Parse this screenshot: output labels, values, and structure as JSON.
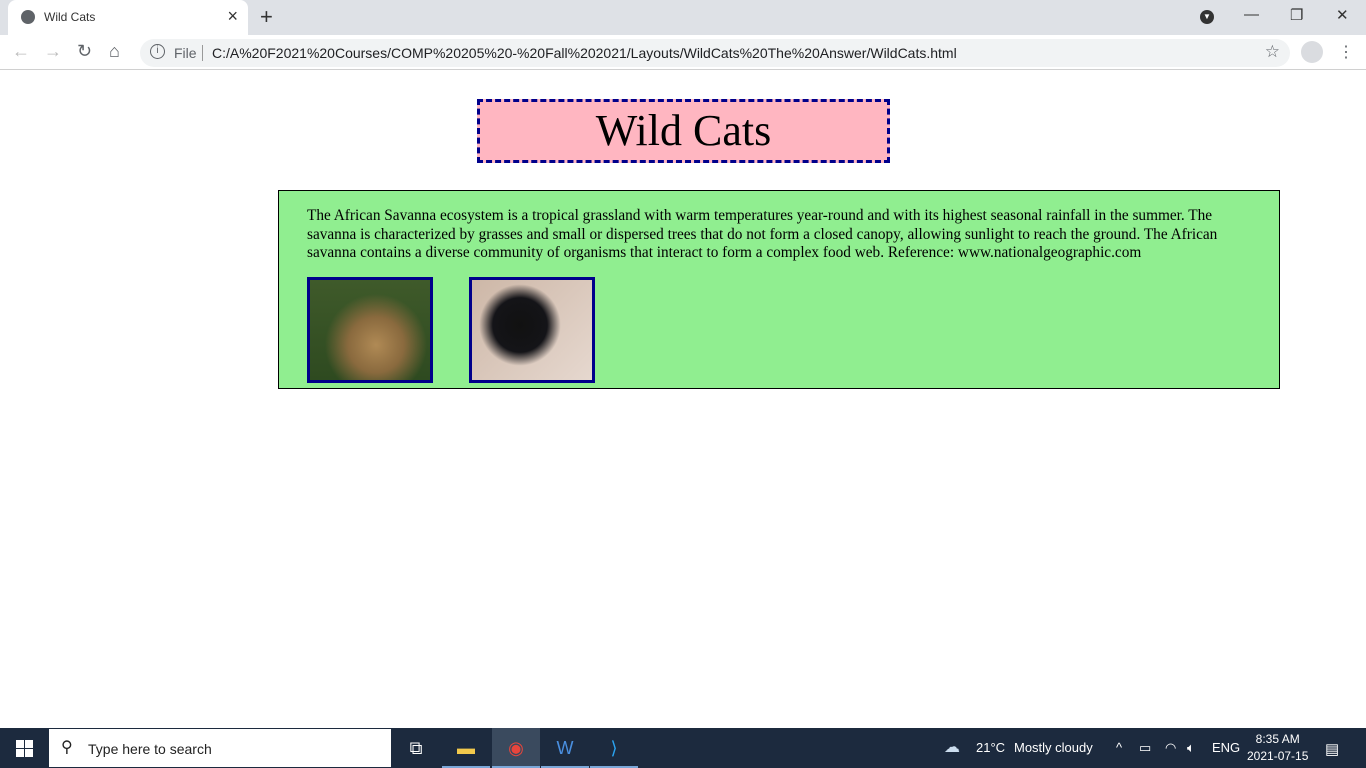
{
  "browser": {
    "tab_title": "Wild Cats",
    "file_label": "File",
    "url": "C:/A%20F2021%20Courses/COMP%20205%20-%20Fall%202021/Layouts/WildCats%20The%20Answer/WildCats.html"
  },
  "page": {
    "heading": "Wild Cats",
    "paragraph": "The African Savanna ecosystem is a tropical grassland with warm temperatures year-round and with its highest seasonal rainfall in the summer. The savanna is characterized by grasses and small or dispersed trees that do not form a closed canopy, allowing sunlight to reach the ground. The African savanna contains a diverse community of organisms that interact to form a complex food web. Reference: www.nationalgeographic.com",
    "images": [
      "leopard",
      "black panther"
    ]
  },
  "taskbar": {
    "search_placeholder": "Type here to search",
    "temperature": "21°C",
    "weather": "Mostly cloudy",
    "language": "ENG",
    "time": "8:35 AM",
    "date": "2021-07-15"
  }
}
